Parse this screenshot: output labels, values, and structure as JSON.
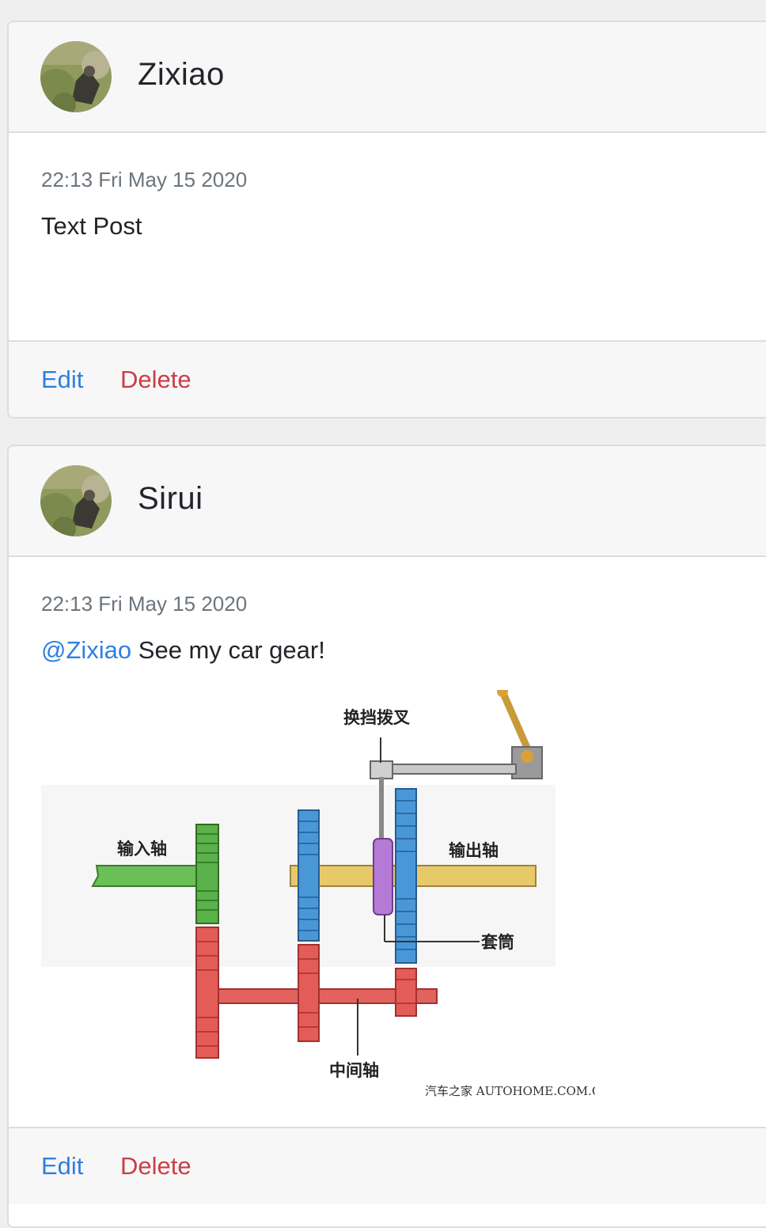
{
  "posts": [
    {
      "author": "Zixiao",
      "timestamp": "22:13 Fri May 15 2020",
      "mention": "",
      "text": "Text Post",
      "actions": {
        "edit": "Edit",
        "delete": "Delete"
      }
    },
    {
      "author": "Sirui",
      "timestamp": "22:13 Fri May 15 2020",
      "mention": "@Zixiao",
      "text": " See my car gear!",
      "image": {
        "labels": {
          "shift_fork": "换挡拨叉",
          "input_shaft": "输入轴",
          "output_shaft": "输出轴",
          "sleeve": "套筒",
          "countershaft": "中间轴",
          "watermark": "汽车之家 AUTOHOME.COM.CN"
        }
      },
      "actions": {
        "edit": "Edit",
        "delete": "Delete"
      }
    }
  ],
  "colors": {
    "link": "#2f7fe0",
    "danger": "#cc3d44",
    "muted": "#6c757d",
    "header_bg": "#f7f7f8",
    "border": "#dcdde0"
  }
}
